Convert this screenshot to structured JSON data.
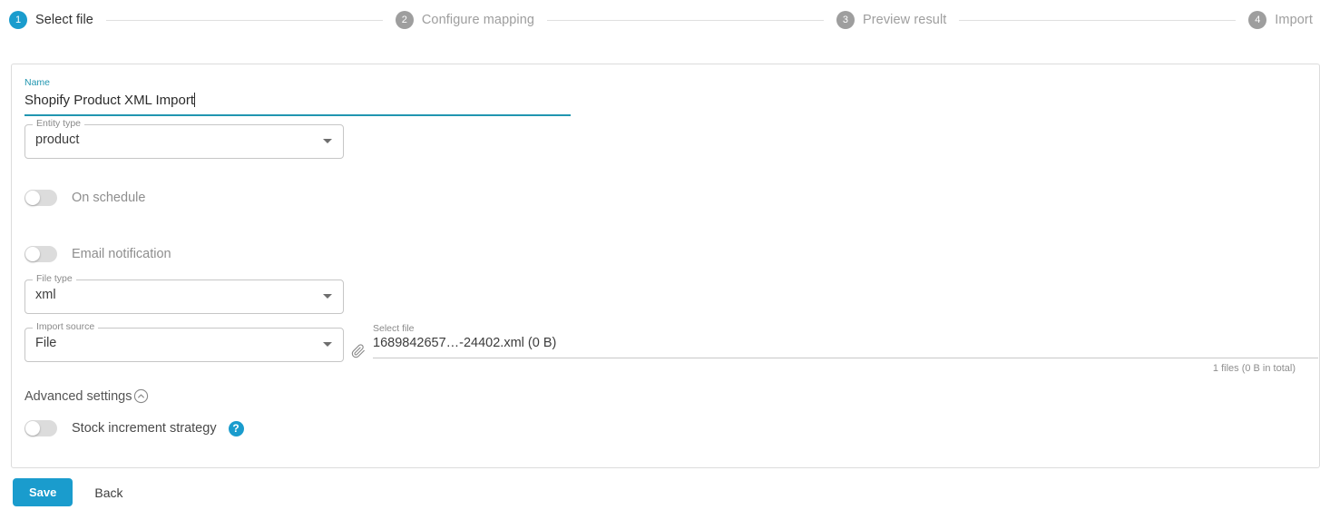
{
  "stepper": {
    "steps": [
      {
        "number": "1",
        "label": "Select file",
        "state": "active"
      },
      {
        "number": "2",
        "label": "Configure mapping",
        "state": "inactive"
      },
      {
        "number": "3",
        "label": "Preview result",
        "state": "inactive"
      },
      {
        "number": "4",
        "label": "Import",
        "state": "inactive"
      }
    ]
  },
  "form": {
    "name": {
      "label": "Name",
      "value": "Shopify Product XML Import"
    },
    "entity_type": {
      "label": "Entity type",
      "value": "product"
    },
    "on_schedule": {
      "label": "On schedule",
      "value": "off"
    },
    "email_notification": {
      "label": "Email notification",
      "value": "off"
    },
    "file_type": {
      "label": "File type",
      "value": "xml"
    },
    "import_source": {
      "label": "Import source",
      "value": "File"
    },
    "select_file": {
      "label": "Select file",
      "value": "1689842657…-24402.xml (0 B)",
      "hint": "1 files (0 B in total)",
      "icon": "paperclip-icon"
    },
    "advanced_settings": {
      "label": "Advanced settings",
      "icon": "chevron-up-circle-icon",
      "expanded": "true"
    },
    "stock_increment_strategy": {
      "label": "Stock increment strategy",
      "value": "off",
      "help_icon": "help-circle-icon",
      "help_glyph": "?"
    }
  },
  "footer": {
    "save_label": "Save",
    "back_label": "Back"
  },
  "colors": {
    "accent": "#1a9ccd",
    "focus_teal": "#2196b0",
    "inactive_gray": "#9e9e9e",
    "border": "#dcdcdc"
  }
}
